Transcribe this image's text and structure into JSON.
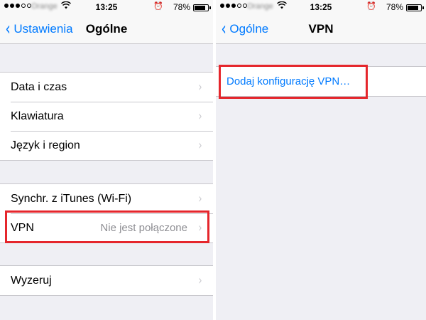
{
  "left": {
    "status": {
      "carrier": "Orange",
      "time": "13:25",
      "battery": "78%",
      "battery_level": 0.78
    },
    "nav": {
      "back_label": "Ustawienia",
      "title": "Ogólne"
    },
    "group1": [
      {
        "label": "Data i czas"
      },
      {
        "label": "Klawiatura"
      },
      {
        "label": "Język i region"
      }
    ],
    "group2": [
      {
        "label": "Synchr. z iTunes (Wi-Fi)"
      },
      {
        "label": "VPN",
        "detail": "Nie jest połączone"
      }
    ],
    "group3": [
      {
        "label": "Wyzeruj"
      }
    ]
  },
  "right": {
    "status": {
      "carrier": "Orange",
      "time": "13:25",
      "battery": "78%",
      "battery_level": 0.78
    },
    "nav": {
      "back_label": "Ogólne",
      "title": "VPN"
    },
    "add_vpn_label": "Dodaj konfigurację VPN…"
  },
  "colors": {
    "accent": "#007aff",
    "highlight": "#e5262c",
    "background": "#efeff4"
  },
  "icons": {
    "back": "chevron-left-icon",
    "disclosure": "chevron-right-icon",
    "wifi": "wifi-icon",
    "alarm": "alarm-icon",
    "battery": "battery-icon"
  }
}
